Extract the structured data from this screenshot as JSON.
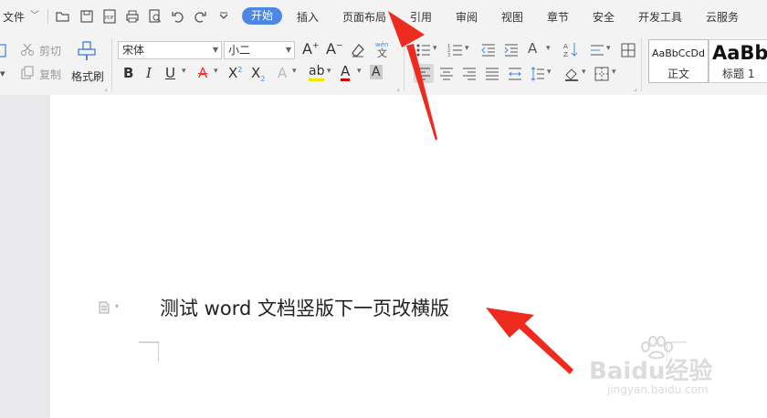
{
  "menubar": {
    "file_label": "文件",
    "tabs": [
      "开始",
      "插入",
      "页面布局",
      "引用",
      "审阅",
      "视图",
      "章节",
      "安全",
      "开发工具",
      "云服务"
    ]
  },
  "ribbon": {
    "cut_label": "剪切",
    "copy_label": "复制",
    "format_painter_label": "格式刷",
    "font_name": "宋体",
    "font_size": "小二",
    "styles": [
      {
        "preview": "AaBbCcDd",
        "label": "正文"
      },
      {
        "preview": "AaBb",
        "label": "标题 1"
      }
    ]
  },
  "document": {
    "text": "测试 word 文档竖版下一页改横版"
  },
  "watermark": {
    "brand": "Baidu经验",
    "url": "jingyan.baidu.com"
  },
  "colors": {
    "accent": "#4d86e3",
    "arrow": "#ee2b1f"
  }
}
